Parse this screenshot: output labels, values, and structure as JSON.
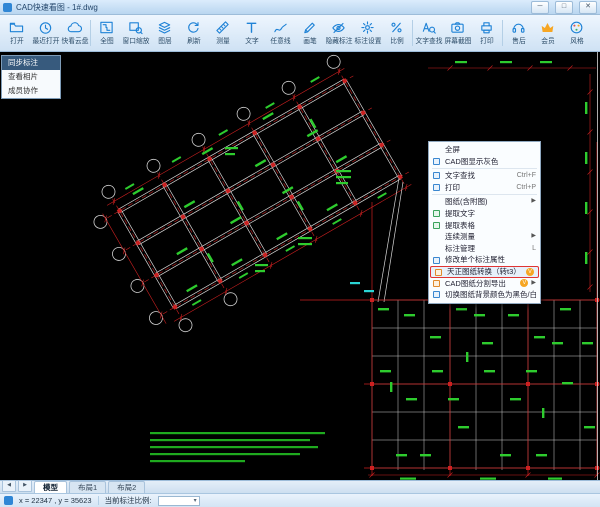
{
  "window": {
    "title": "CAD快速看图 - 1#.dwg",
    "minimize": "─",
    "maximize": "□",
    "close": "✕"
  },
  "toolbar": {
    "items": [
      {
        "label": "打开"
      },
      {
        "label": "最近打开"
      },
      {
        "label": "快看云盘"
      },
      {
        "label": "全图"
      },
      {
        "label": "窗口缩放"
      },
      {
        "label": "图层"
      },
      {
        "label": "刷新"
      },
      {
        "label": "测量"
      },
      {
        "label": "文字"
      },
      {
        "label": "任意线"
      },
      {
        "label": "画笔"
      },
      {
        "label": "隐藏标注"
      },
      {
        "label": "标注设置"
      },
      {
        "label": "比例"
      },
      {
        "label": "文字查找"
      },
      {
        "label": "屏幕截图"
      },
      {
        "label": "打印"
      },
      {
        "label": "售后"
      },
      {
        "label": "会员"
      },
      {
        "label": "风格"
      }
    ]
  },
  "quick_menu": {
    "items": [
      {
        "label": "同步标注"
      },
      {
        "label": "查看相片"
      },
      {
        "label": "成员协作"
      }
    ]
  },
  "context_menu": {
    "items": [
      {
        "label": "全屏"
      },
      {
        "label": "CAD图显示灰色"
      },
      {
        "label": "文字查找",
        "shortcut": "Ctrl+F"
      },
      {
        "label": "打印",
        "shortcut": "Ctrl+P"
      },
      {
        "label": "图纸(含附图)",
        "arrow": "▶"
      },
      {
        "label": "提取文字"
      },
      {
        "label": "提取表格"
      },
      {
        "label": "连续测量",
        "arrow": "▶"
      },
      {
        "label": "标注管理",
        "shortcut": "L"
      },
      {
        "label": "修改单个标注属性"
      },
      {
        "label": "天正图纸转换（转t3）",
        "vip": "V"
      },
      {
        "label": "CAD图纸分割导出",
        "vip": "V",
        "arrow": "▶"
      },
      {
        "label": "切换图纸背景颜色为黑色/白色"
      }
    ]
  },
  "tabs": {
    "nav_prev": "◀",
    "nav_next": "▶",
    "items": [
      {
        "label": "模型"
      },
      {
        "label": "布局1"
      },
      {
        "label": "布局2"
      }
    ],
    "active": "模型"
  },
  "status": {
    "coordinates": "x = 22347 , y = 35623",
    "scale_label": "当前标注比例:",
    "scale_caret": "▾"
  },
  "colors": {
    "accent_blue": "#1e82d6",
    "vip_orange": "#f6a623",
    "highlight_red": "#e03434",
    "cad_green": "#2ecc2e",
    "cad_red": "#cc2020",
    "cad_white": "#d9d9d9",
    "canvas_bg": "#000000"
  }
}
